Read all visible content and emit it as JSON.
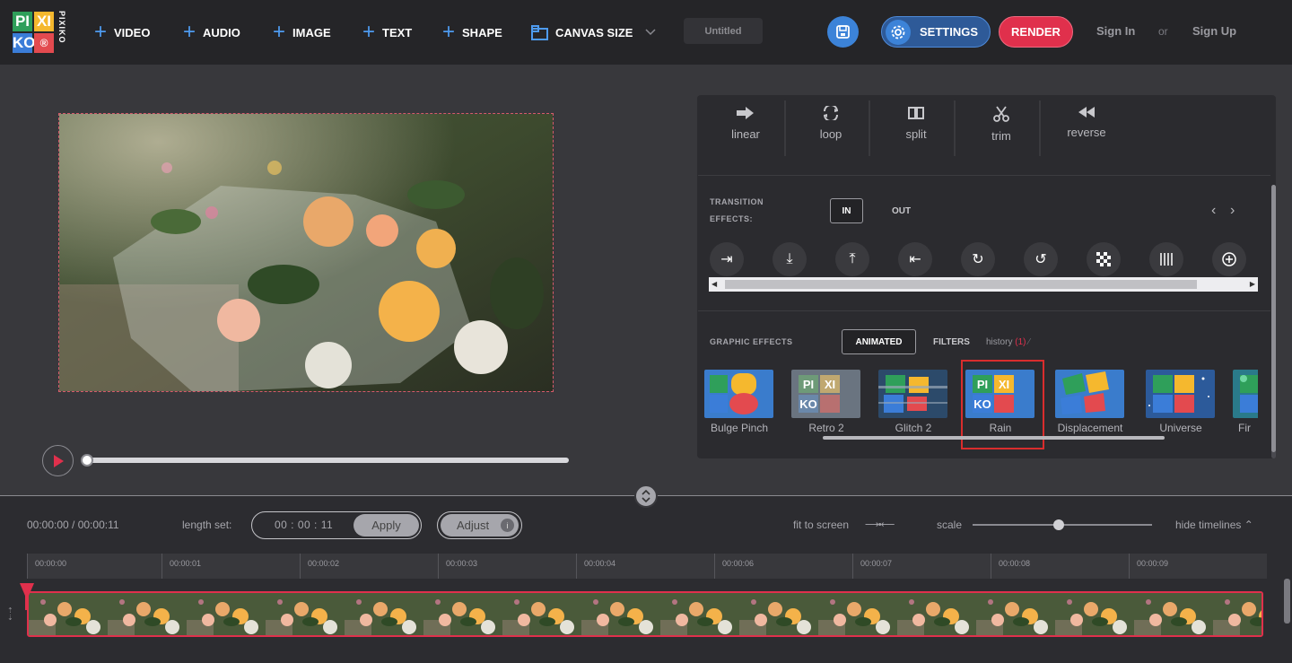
{
  "header": {
    "logo": {
      "letters": [
        "PI",
        "XI",
        "KO",
        "®"
      ],
      "side_text": "PIXIKO",
      "colors": [
        "#e34a4f",
        "#f5b82e",
        "#2f9f5a",
        "#3b7dd8"
      ]
    },
    "nav": [
      {
        "label": "VIDEO",
        "icon": "plus-icon"
      },
      {
        "label": "AUDIO",
        "icon": "plus-icon"
      },
      {
        "label": "IMAGE",
        "icon": "plus-icon"
      },
      {
        "label": "TEXT",
        "icon": "plus-icon"
      },
      {
        "label": "SHAPE",
        "icon": "plus-icon"
      }
    ],
    "canvas_size_label": "CANVAS SIZE",
    "project_title": "Untitled",
    "settings_label": "SETTINGS",
    "render_label": "RENDER",
    "sign_in": "Sign In",
    "or": "or",
    "sign_up": "Sign Up"
  },
  "tools": [
    {
      "label": "linear",
      "icon": "linear-arrow-icon"
    },
    {
      "label": "loop",
      "icon": "loop-icon"
    },
    {
      "label": "split",
      "icon": "split-icon"
    },
    {
      "label": "trim",
      "icon": "scissors-icon"
    },
    {
      "label": "reverse",
      "icon": "rewind-icon"
    }
  ],
  "transitions": {
    "label_line1": "TRANSITION",
    "label_line2": "EFFECTS:",
    "tab_in": "IN",
    "tab_out": "OUT",
    "icons": [
      "slide-right-icon",
      "slide-down-icon",
      "slide-up-icon",
      "slide-left-icon",
      "rotate-cw-icon",
      "rotate-ccw-icon",
      "dissolve-icon",
      "blinds-icon",
      "zoom-in-icon"
    ]
  },
  "graphic_effects": {
    "label": "GRAPHIC EFFECTS",
    "tab_animated": "ANIMATED",
    "tab_filters": "FILTERS",
    "history_label": "history",
    "history_count": "(1)",
    "items": [
      {
        "name": "Bulge Pinch",
        "selected": false
      },
      {
        "name": "Retro 2",
        "selected": false
      },
      {
        "name": "Glitch 2",
        "selected": false
      },
      {
        "name": "Rain",
        "selected": true
      },
      {
        "name": "Displacement",
        "selected": false
      },
      {
        "name": "Universe",
        "selected": false
      },
      {
        "name": "Fir",
        "selected": false
      }
    ]
  },
  "timeline": {
    "time_readout": "00:00:00 / 00:00:11",
    "length_label": "length set:",
    "length_value": "00 : 00 : 11",
    "apply_label": "Apply",
    "adjust_label": "Adjust",
    "adjust_info": "i",
    "fit_label": "fit to screen",
    "scale_label": "scale",
    "scale_value": 0.5,
    "hide_label": "hide timelines",
    "ticks": [
      "00:00:00",
      "00:00:01",
      "00:00:02",
      "00:00:03",
      "00:00:04",
      "00:00:06",
      "00:00:07",
      "00:00:08",
      "00:00:09"
    ]
  },
  "colors": {
    "accent_blue": "#3c83d8",
    "render_red": "#e0304c",
    "highlight_red": "#d92d2d"
  }
}
